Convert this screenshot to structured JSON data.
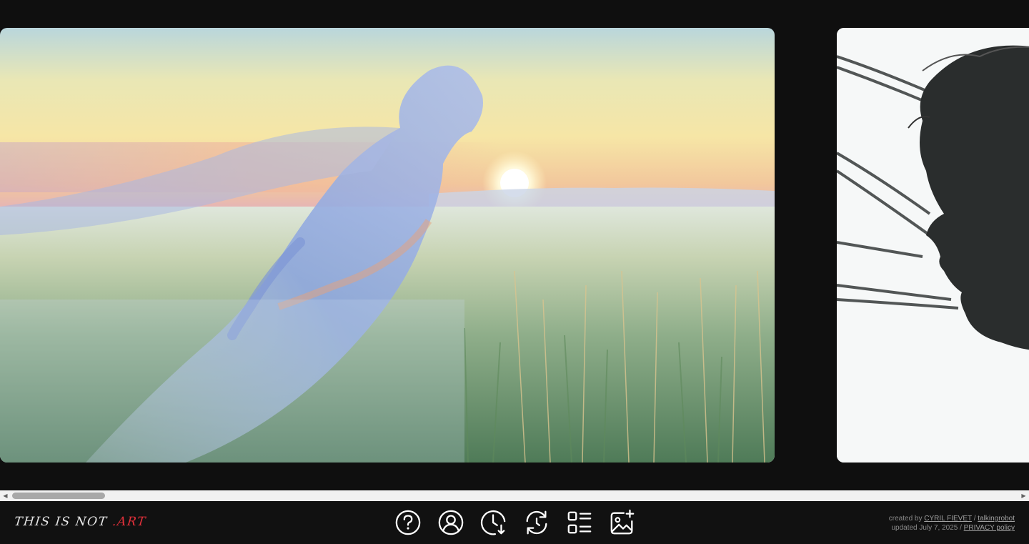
{
  "gallery": {
    "images": [
      {
        "alt": ""
      },
      {
        "alt": ""
      }
    ]
  },
  "scrollbar": {
    "left_arrow": "◀",
    "right_arrow": "▶"
  },
  "footer": {
    "logo_prefix": "THIS IS NOT ",
    "logo_accent": ".ART",
    "toolbar": [
      {
        "icon": "help-icon"
      },
      {
        "icon": "user-icon"
      },
      {
        "icon": "clock-download-icon"
      },
      {
        "icon": "refresh-icon"
      },
      {
        "icon": "list-view-icon"
      },
      {
        "icon": "add-image-icon"
      }
    ],
    "credits": {
      "created_by": "created by ",
      "author": "CYRIL FIEVET",
      "separator": " / ",
      "handle": "talkingrobot",
      "updated": "updated July 7, 2025",
      "separator2": " / ",
      "privacy": "PRIVACY policy"
    }
  },
  "colors": {
    "background": "#0f0f0f",
    "accent": "#e0303a",
    "icon": "#ffffff"
  }
}
